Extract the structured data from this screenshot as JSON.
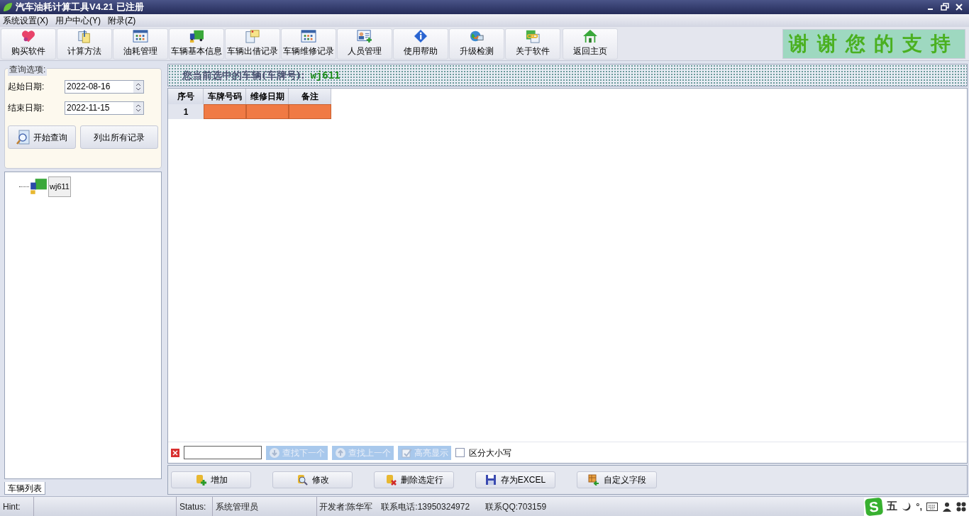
{
  "window": {
    "title": "汽车油耗计算工具V4.21 已注册"
  },
  "menu": [
    "系统设置(X)",
    "用户中心(Y)",
    "附录(Z)"
  ],
  "toolbar": [
    {
      "label": "购买软件",
      "kind": "heart"
    },
    {
      "label": "计算方法",
      "kind": "clip"
    },
    {
      "label": "油耗管理",
      "kind": "grid"
    },
    {
      "label": "车辆基本信息",
      "kind": "truck"
    },
    {
      "label": "车辆出借记录",
      "kind": "note"
    },
    {
      "label": "车辆维修记录",
      "kind": "grid"
    },
    {
      "label": "人员管理",
      "kind": "card"
    },
    {
      "label": "使用帮助",
      "kind": "info"
    },
    {
      "label": "升级检测",
      "kind": "globe"
    },
    {
      "label": "关于软件",
      "kind": "link"
    },
    {
      "label": "返回主页",
      "kind": "home"
    }
  ],
  "banner": "谢谢您的支持",
  "query": {
    "legend": "查询选项:",
    "start_label": "起始日期:",
    "start_value": "2022-08-16",
    "end_label": "结束日期:",
    "end_value": "2022-11-15",
    "search_button": "开始查询",
    "list_all_button": "列出所有记录"
  },
  "tree": [
    {
      "label": "wj611",
      "selected": true
    }
  ],
  "left_tabs": [
    {
      "label": "车辆列表",
      "selected": true
    }
  ],
  "selected_vehicle": {
    "label": "您当前选中的车辆(车牌号):",
    "value": "wj611"
  },
  "table": {
    "columns": [
      "序号",
      "车牌号码",
      "维修日期",
      "备注"
    ],
    "rows": [
      {
        "number": "1",
        "selected": true
      }
    ]
  },
  "find_bar": {
    "buttons": [
      {
        "label": "查找下一个",
        "kind": "down",
        "disabled": true
      },
      {
        "label": "查找上一个",
        "kind": "up",
        "disabled": true
      },
      {
        "label": "高亮显示",
        "kind": "mark",
        "disabled": true
      }
    ],
    "case_label": "区分大小写",
    "case_checked": false
  },
  "actions": [
    {
      "label": "增加",
      "kind": "add"
    },
    {
      "label": "修改",
      "kind": "edit"
    },
    {
      "label": "删除选定行",
      "kind": "delete"
    },
    {
      "label": "存为EXCEL",
      "kind": "save"
    },
    {
      "label": "自定义字段",
      "kind": "custom"
    }
  ],
  "status_bar": {
    "hint_label": "Hint:",
    "status_label": "Status:",
    "status_value": "系统管理员",
    "developer": "开发者:陈华军",
    "phone": "联系电话:13950324972",
    "qq": "联系QQ:703159"
  },
  "ime": {
    "logo": "S",
    "mode": "五",
    "punct": "°,"
  }
}
